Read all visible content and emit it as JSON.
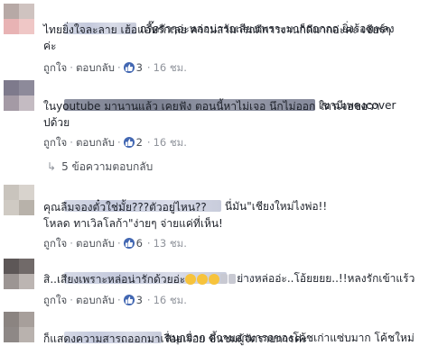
{
  "comments": [
    {
      "text_line1": "กรี๊ดรัวๆอ่ะหล่อน่ารักเสียงเพราะมากกกกกก ยิ่งร้องเพลง",
      "text_line2": "ไทยยิ่งใจละลาย เฮ้อแอบรักเลย ความสามารถดีการงานก็ดีมากอ่ะค่ะ เชียร์ๆ",
      "text_line3": "ค่ะ",
      "like_label": "ถูกใจ",
      "reply_label": "ตอบกลับ",
      "likes": "3",
      "time": "16 ชม."
    },
    {
      "text_line1": "เขามีเพลงcover",
      "text_line2": "ในyoutube มานานแล้ว เคยฟัง ตอนนี้หาไม่เจอ นึกไม่ออก ใครเจอขอวา",
      "text_line3": "ปด้วย",
      "like_label": "ถูกใจ",
      "reply_label": "ตอบกลับ",
      "likes": "2",
      "time": "16 ชม."
    },
    {
      "text_line1": "นี่มัน\"เชียงใหม่ไงพ่อ!!",
      "text_line2": "คุณลืมจองตั๋วใช่มั้ย???ตัวอยู่ไหน??",
      "text_line3": "โหลด ทาเวิลโลก้า\"ง่ายๆ จ่ายแค่ที่เห็น!",
      "like_label": "ถูกใจ",
      "reply_label": "ตอบกลับ",
      "likes": "6",
      "time": "13 ชม."
    },
    {
      "text_line1": "อย่างหล่ออ่ะ..โอ้ยยยย..!!หลงรักเข้าแร้ว",
      "text_line2": "สิ..เสียงเพราะหล่อน่ารักด้วยอ่ะ",
      "like_label": "ถูกใจ",
      "reply_label": "ตอบกลับ",
      "likes": "3",
      "time": "16 ชม."
    },
    {
      "text_line1": "สนุกมาก ความสามารถของโค้ชเก่าแซ่บมาก โค้ชใหม่",
      "text_line2": "ก็แสดงความสารถออกมาเรื่อยเรื่อย ขึ้นชมผู้จัดรายการค่ะ"
    }
  ],
  "replies_link": "5 ข้อความตอบกลับ",
  "colors": {
    "link": "#4b4f56",
    "meta": "#90949c",
    "like_badge": "#4267b2"
  }
}
